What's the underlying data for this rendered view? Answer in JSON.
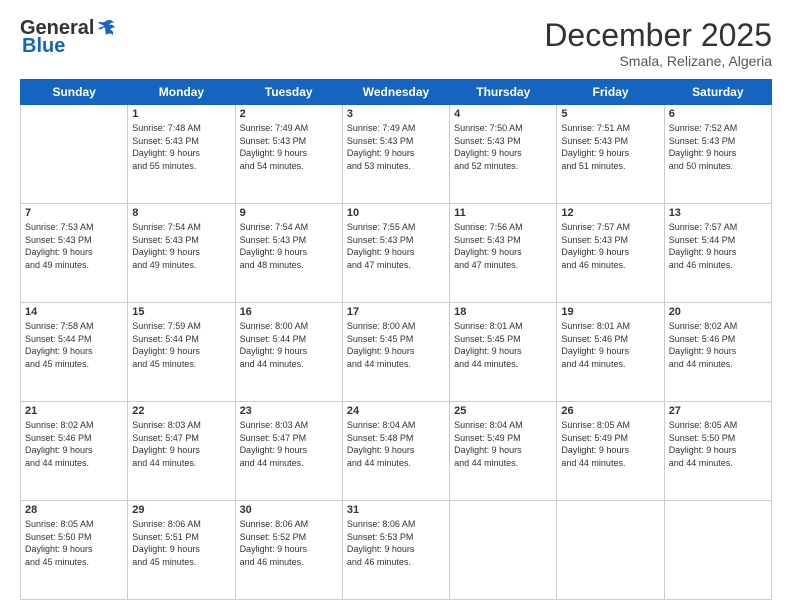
{
  "logo": {
    "general": "General",
    "blue": "Blue"
  },
  "header": {
    "month": "December 2025",
    "location": "Smala, Relizane, Algeria"
  },
  "weekdays": [
    "Sunday",
    "Monday",
    "Tuesday",
    "Wednesday",
    "Thursday",
    "Friday",
    "Saturday"
  ],
  "weeks": [
    [
      {
        "day": "",
        "sunrise": "",
        "sunset": "",
        "daylight": ""
      },
      {
        "day": "1",
        "sunrise": "Sunrise: 7:48 AM",
        "sunset": "Sunset: 5:43 PM",
        "daylight": "Daylight: 9 hours and 55 minutes."
      },
      {
        "day": "2",
        "sunrise": "Sunrise: 7:49 AM",
        "sunset": "Sunset: 5:43 PM",
        "daylight": "Daylight: 9 hours and 54 minutes."
      },
      {
        "day": "3",
        "sunrise": "Sunrise: 7:49 AM",
        "sunset": "Sunset: 5:43 PM",
        "daylight": "Daylight: 9 hours and 53 minutes."
      },
      {
        "day": "4",
        "sunrise": "Sunrise: 7:50 AM",
        "sunset": "Sunset: 5:43 PM",
        "daylight": "Daylight: 9 hours and 52 minutes."
      },
      {
        "day": "5",
        "sunrise": "Sunrise: 7:51 AM",
        "sunset": "Sunset: 5:43 PM",
        "daylight": "Daylight: 9 hours and 51 minutes."
      },
      {
        "day": "6",
        "sunrise": "Sunrise: 7:52 AM",
        "sunset": "Sunset: 5:43 PM",
        "daylight": "Daylight: 9 hours and 50 minutes."
      }
    ],
    [
      {
        "day": "7",
        "sunrise": "Sunrise: 7:53 AM",
        "sunset": "Sunset: 5:43 PM",
        "daylight": "Daylight: 9 hours and 49 minutes."
      },
      {
        "day": "8",
        "sunrise": "Sunrise: 7:54 AM",
        "sunset": "Sunset: 5:43 PM",
        "daylight": "Daylight: 9 hours and 49 minutes."
      },
      {
        "day": "9",
        "sunrise": "Sunrise: 7:54 AM",
        "sunset": "Sunset: 5:43 PM",
        "daylight": "Daylight: 9 hours and 48 minutes."
      },
      {
        "day": "10",
        "sunrise": "Sunrise: 7:55 AM",
        "sunset": "Sunset: 5:43 PM",
        "daylight": "Daylight: 9 hours and 47 minutes."
      },
      {
        "day": "11",
        "sunrise": "Sunrise: 7:56 AM",
        "sunset": "Sunset: 5:43 PM",
        "daylight": "Daylight: 9 hours and 47 minutes."
      },
      {
        "day": "12",
        "sunrise": "Sunrise: 7:57 AM",
        "sunset": "Sunset: 5:43 PM",
        "daylight": "Daylight: 9 hours and 46 minutes."
      },
      {
        "day": "13",
        "sunrise": "Sunrise: 7:57 AM",
        "sunset": "Sunset: 5:44 PM",
        "daylight": "Daylight: 9 hours and 46 minutes."
      }
    ],
    [
      {
        "day": "14",
        "sunrise": "Sunrise: 7:58 AM",
        "sunset": "Sunset: 5:44 PM",
        "daylight": "Daylight: 9 hours and 45 minutes."
      },
      {
        "day": "15",
        "sunrise": "Sunrise: 7:59 AM",
        "sunset": "Sunset: 5:44 PM",
        "daylight": "Daylight: 9 hours and 45 minutes."
      },
      {
        "day": "16",
        "sunrise": "Sunrise: 8:00 AM",
        "sunset": "Sunset: 5:44 PM",
        "daylight": "Daylight: 9 hours and 44 minutes."
      },
      {
        "day": "17",
        "sunrise": "Sunrise: 8:00 AM",
        "sunset": "Sunset: 5:45 PM",
        "daylight": "Daylight: 9 hours and 44 minutes."
      },
      {
        "day": "18",
        "sunrise": "Sunrise: 8:01 AM",
        "sunset": "Sunset: 5:45 PM",
        "daylight": "Daylight: 9 hours and 44 minutes."
      },
      {
        "day": "19",
        "sunrise": "Sunrise: 8:01 AM",
        "sunset": "Sunset: 5:46 PM",
        "daylight": "Daylight: 9 hours and 44 minutes."
      },
      {
        "day": "20",
        "sunrise": "Sunrise: 8:02 AM",
        "sunset": "Sunset: 5:46 PM",
        "daylight": "Daylight: 9 hours and 44 minutes."
      }
    ],
    [
      {
        "day": "21",
        "sunrise": "Sunrise: 8:02 AM",
        "sunset": "Sunset: 5:46 PM",
        "daylight": "Daylight: 9 hours and 44 minutes."
      },
      {
        "day": "22",
        "sunrise": "Sunrise: 8:03 AM",
        "sunset": "Sunset: 5:47 PM",
        "daylight": "Daylight: 9 hours and 44 minutes."
      },
      {
        "day": "23",
        "sunrise": "Sunrise: 8:03 AM",
        "sunset": "Sunset: 5:47 PM",
        "daylight": "Daylight: 9 hours and 44 minutes."
      },
      {
        "day": "24",
        "sunrise": "Sunrise: 8:04 AM",
        "sunset": "Sunset: 5:48 PM",
        "daylight": "Daylight: 9 hours and 44 minutes."
      },
      {
        "day": "25",
        "sunrise": "Sunrise: 8:04 AM",
        "sunset": "Sunset: 5:49 PM",
        "daylight": "Daylight: 9 hours and 44 minutes."
      },
      {
        "day": "26",
        "sunrise": "Sunrise: 8:05 AM",
        "sunset": "Sunset: 5:49 PM",
        "daylight": "Daylight: 9 hours and 44 minutes."
      },
      {
        "day": "27",
        "sunrise": "Sunrise: 8:05 AM",
        "sunset": "Sunset: 5:50 PM",
        "daylight": "Daylight: 9 hours and 44 minutes."
      }
    ],
    [
      {
        "day": "28",
        "sunrise": "Sunrise: 8:05 AM",
        "sunset": "Sunset: 5:50 PM",
        "daylight": "Daylight: 9 hours and 45 minutes."
      },
      {
        "day": "29",
        "sunrise": "Sunrise: 8:06 AM",
        "sunset": "Sunset: 5:51 PM",
        "daylight": "Daylight: 9 hours and 45 minutes."
      },
      {
        "day": "30",
        "sunrise": "Sunrise: 8:06 AM",
        "sunset": "Sunset: 5:52 PM",
        "daylight": "Daylight: 9 hours and 46 minutes."
      },
      {
        "day": "31",
        "sunrise": "Sunrise: 8:06 AM",
        "sunset": "Sunset: 5:53 PM",
        "daylight": "Daylight: 9 hours and 46 minutes."
      },
      {
        "day": "",
        "sunrise": "",
        "sunset": "",
        "daylight": ""
      },
      {
        "day": "",
        "sunrise": "",
        "sunset": "",
        "daylight": ""
      },
      {
        "day": "",
        "sunrise": "",
        "sunset": "",
        "daylight": ""
      }
    ]
  ]
}
